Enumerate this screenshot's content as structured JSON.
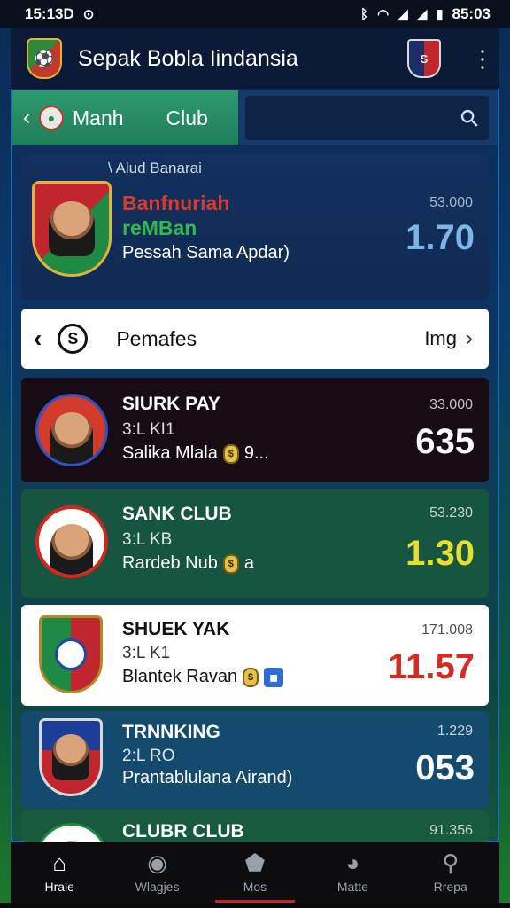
{
  "status": {
    "time": "15:13D",
    "right_time": "85:03"
  },
  "app": {
    "title": "Sepak Bobla  Iindansia"
  },
  "tabs": {
    "match": "Manh",
    "club": "Club"
  },
  "search": {
    "placeholder": ""
  },
  "featured": {
    "tag": "\\ Alud Banarai",
    "name1": "Banfnuriah",
    "name2": "reMBan",
    "sub": "Pessah Sama Apdar)",
    "small": "53.000",
    "score": "1.70"
  },
  "pref": {
    "title": "Pemafes",
    "right": "Img"
  },
  "cards": [
    {
      "title": "SIURK PAY",
      "sub": "3:L KI1",
      "line": "Salika Mlala",
      "suffix": "9...",
      "small": "33.000",
      "score": "635",
      "score_color": "#ffffff"
    },
    {
      "title": "SANK CLUB",
      "sub": "3:L KB",
      "line": "Rardeb Nub",
      "suffix": "a",
      "small": "53.230",
      "score": "1.30",
      "score_color": "#e6e02c"
    },
    {
      "title": "SHUEK YAK",
      "sub": "3:L K1",
      "line": "Blantek Ravan",
      "suffix": "",
      "small": "171.008",
      "score": "11.57",
      "score_color": "#d62b22"
    },
    {
      "title": "TRNNKING",
      "sub": "2:L RO",
      "line": "Prantablulana Airand)",
      "suffix": "",
      "small": "1.229",
      "score": "053",
      "score_color": "#ffffff"
    },
    {
      "title": "CLUBR CLUB",
      "small": "91.356"
    }
  ],
  "nav": [
    {
      "label": "Hrale",
      "icon": "home-icon"
    },
    {
      "label": "Wlagjes",
      "icon": "ball-icon"
    },
    {
      "label": "Mos",
      "icon": "badge-icon"
    },
    {
      "label": "Matte",
      "icon": "face-icon"
    },
    {
      "label": "Rrepa",
      "icon": "search-icon"
    }
  ],
  "colors": {
    "accent_green": "#2e9a6e",
    "accent_red": "#c0262d",
    "navy": "#0b1a36"
  }
}
